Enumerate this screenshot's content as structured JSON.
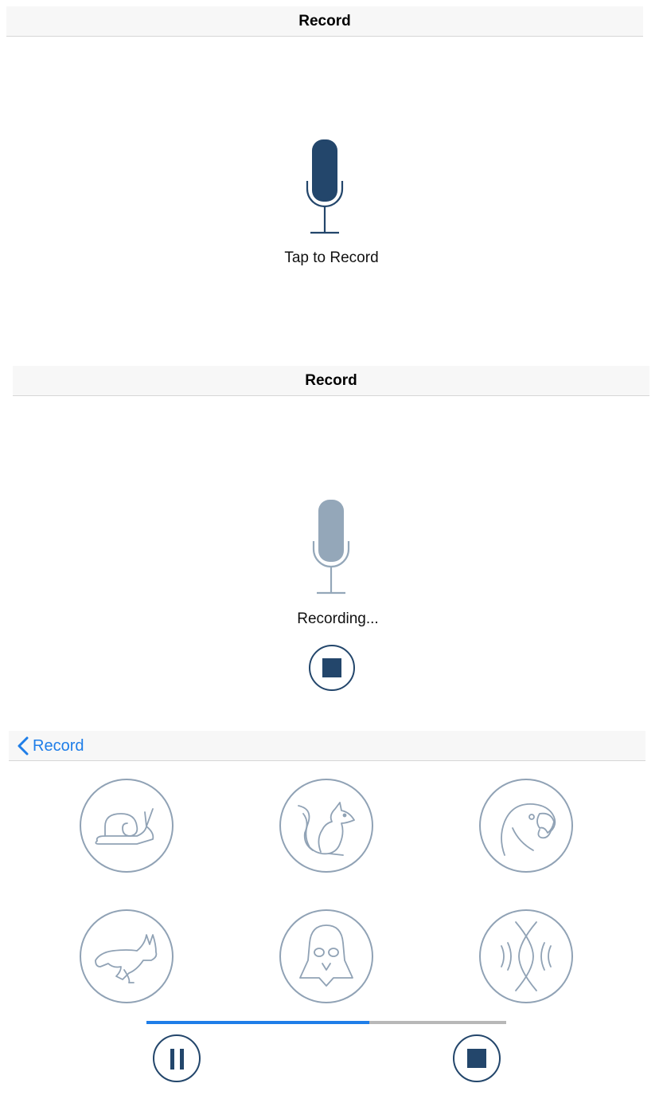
{
  "screen1": {
    "nav_title": "Record",
    "caption": "Tap to Record"
  },
  "screen2": {
    "nav_title": "Record",
    "caption": "Recording..."
  },
  "screen3": {
    "back_label": "Record",
    "effects": [
      {
        "name": "snail",
        "icon": "snail-icon"
      },
      {
        "name": "squirrel",
        "icon": "squirrel-icon"
      },
      {
        "name": "parrot",
        "icon": "parrot-icon"
      },
      {
        "name": "rabbit",
        "icon": "rabbit-icon"
      },
      {
        "name": "darth-vader",
        "icon": "darth-vader-icon"
      },
      {
        "name": "echo",
        "icon": "echo-icon"
      }
    ],
    "playback_progress": 0.62
  },
  "colors": {
    "accent_blue": "#1f7ee8",
    "dark_navy": "#23466b",
    "muted_gray_blue": "#90a2b5",
    "navbar_bg": "#f7f7f7"
  }
}
